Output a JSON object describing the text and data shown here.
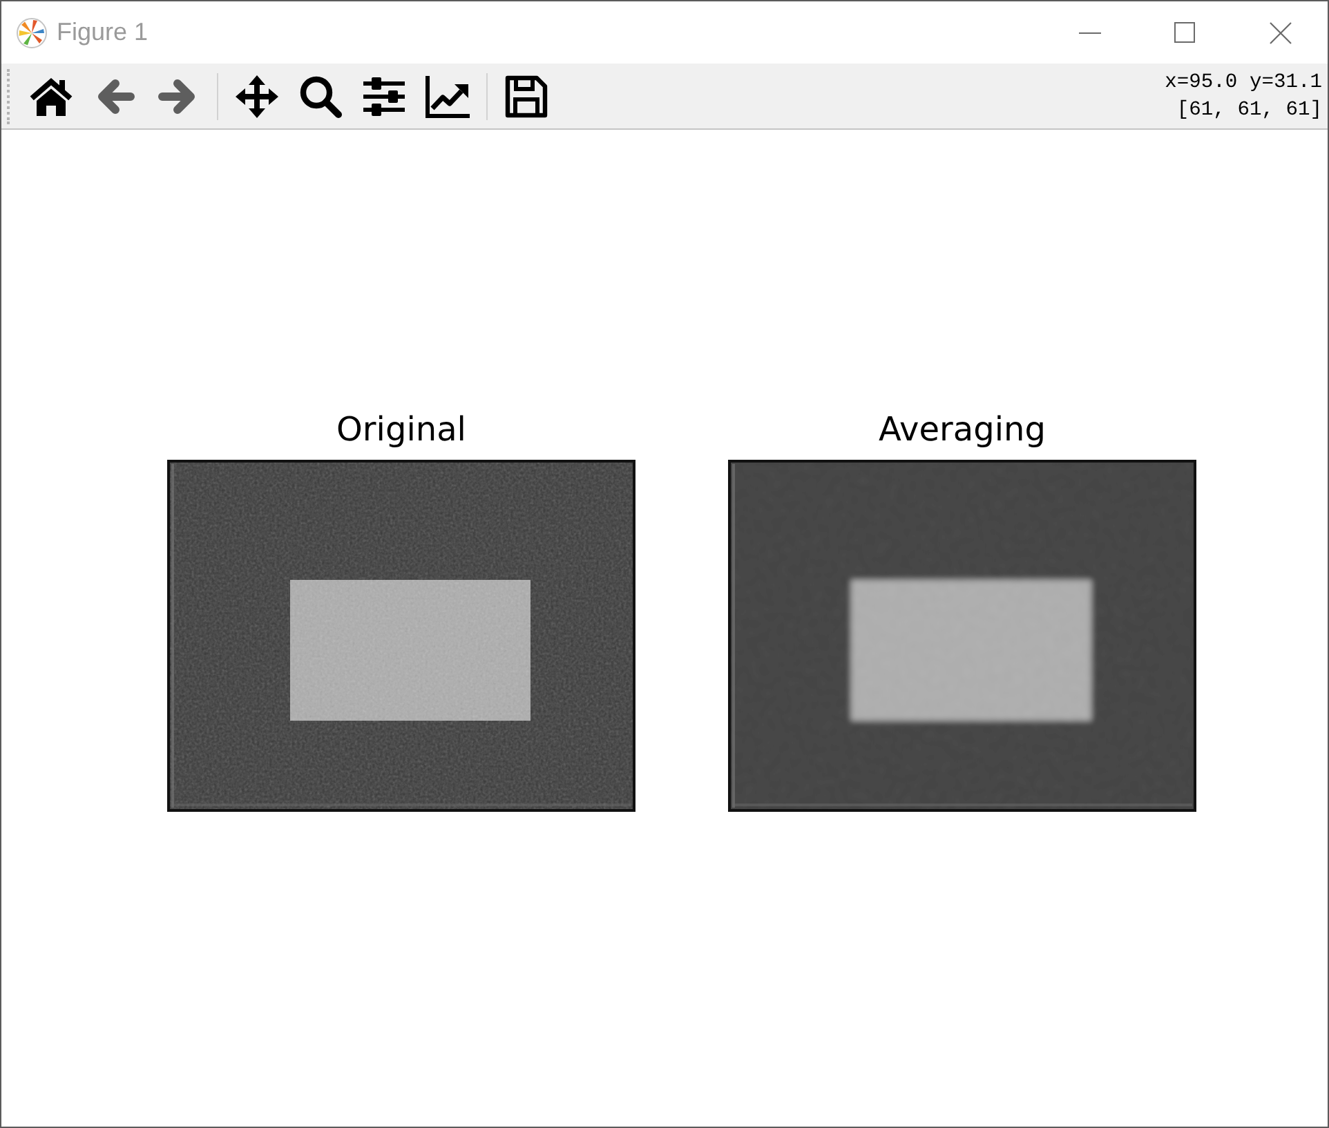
{
  "window": {
    "title": "Figure 1"
  },
  "toolbar": {
    "groups": [
      {
        "buttons": [
          {
            "kind": "home",
            "disabled": false
          },
          {
            "kind": "back",
            "disabled": true
          },
          {
            "kind": "forward",
            "disabled": true
          }
        ]
      },
      {
        "buttons": [
          {
            "kind": "pan",
            "disabled": false
          },
          {
            "kind": "zoom",
            "disabled": false
          },
          {
            "kind": "subplots",
            "disabled": false
          },
          {
            "kind": "customize",
            "disabled": false
          }
        ]
      },
      {
        "buttons": [
          {
            "kind": "save",
            "disabled": false
          }
        ]
      }
    ],
    "readout": {
      "position": "x=95.0 y=31.1",
      "pixel_value": "[61, 61, 61]"
    }
  },
  "subplots": [
    {
      "title": "Original",
      "blurred": false
    },
    {
      "title": "Averaging",
      "blurred": true
    }
  ]
}
